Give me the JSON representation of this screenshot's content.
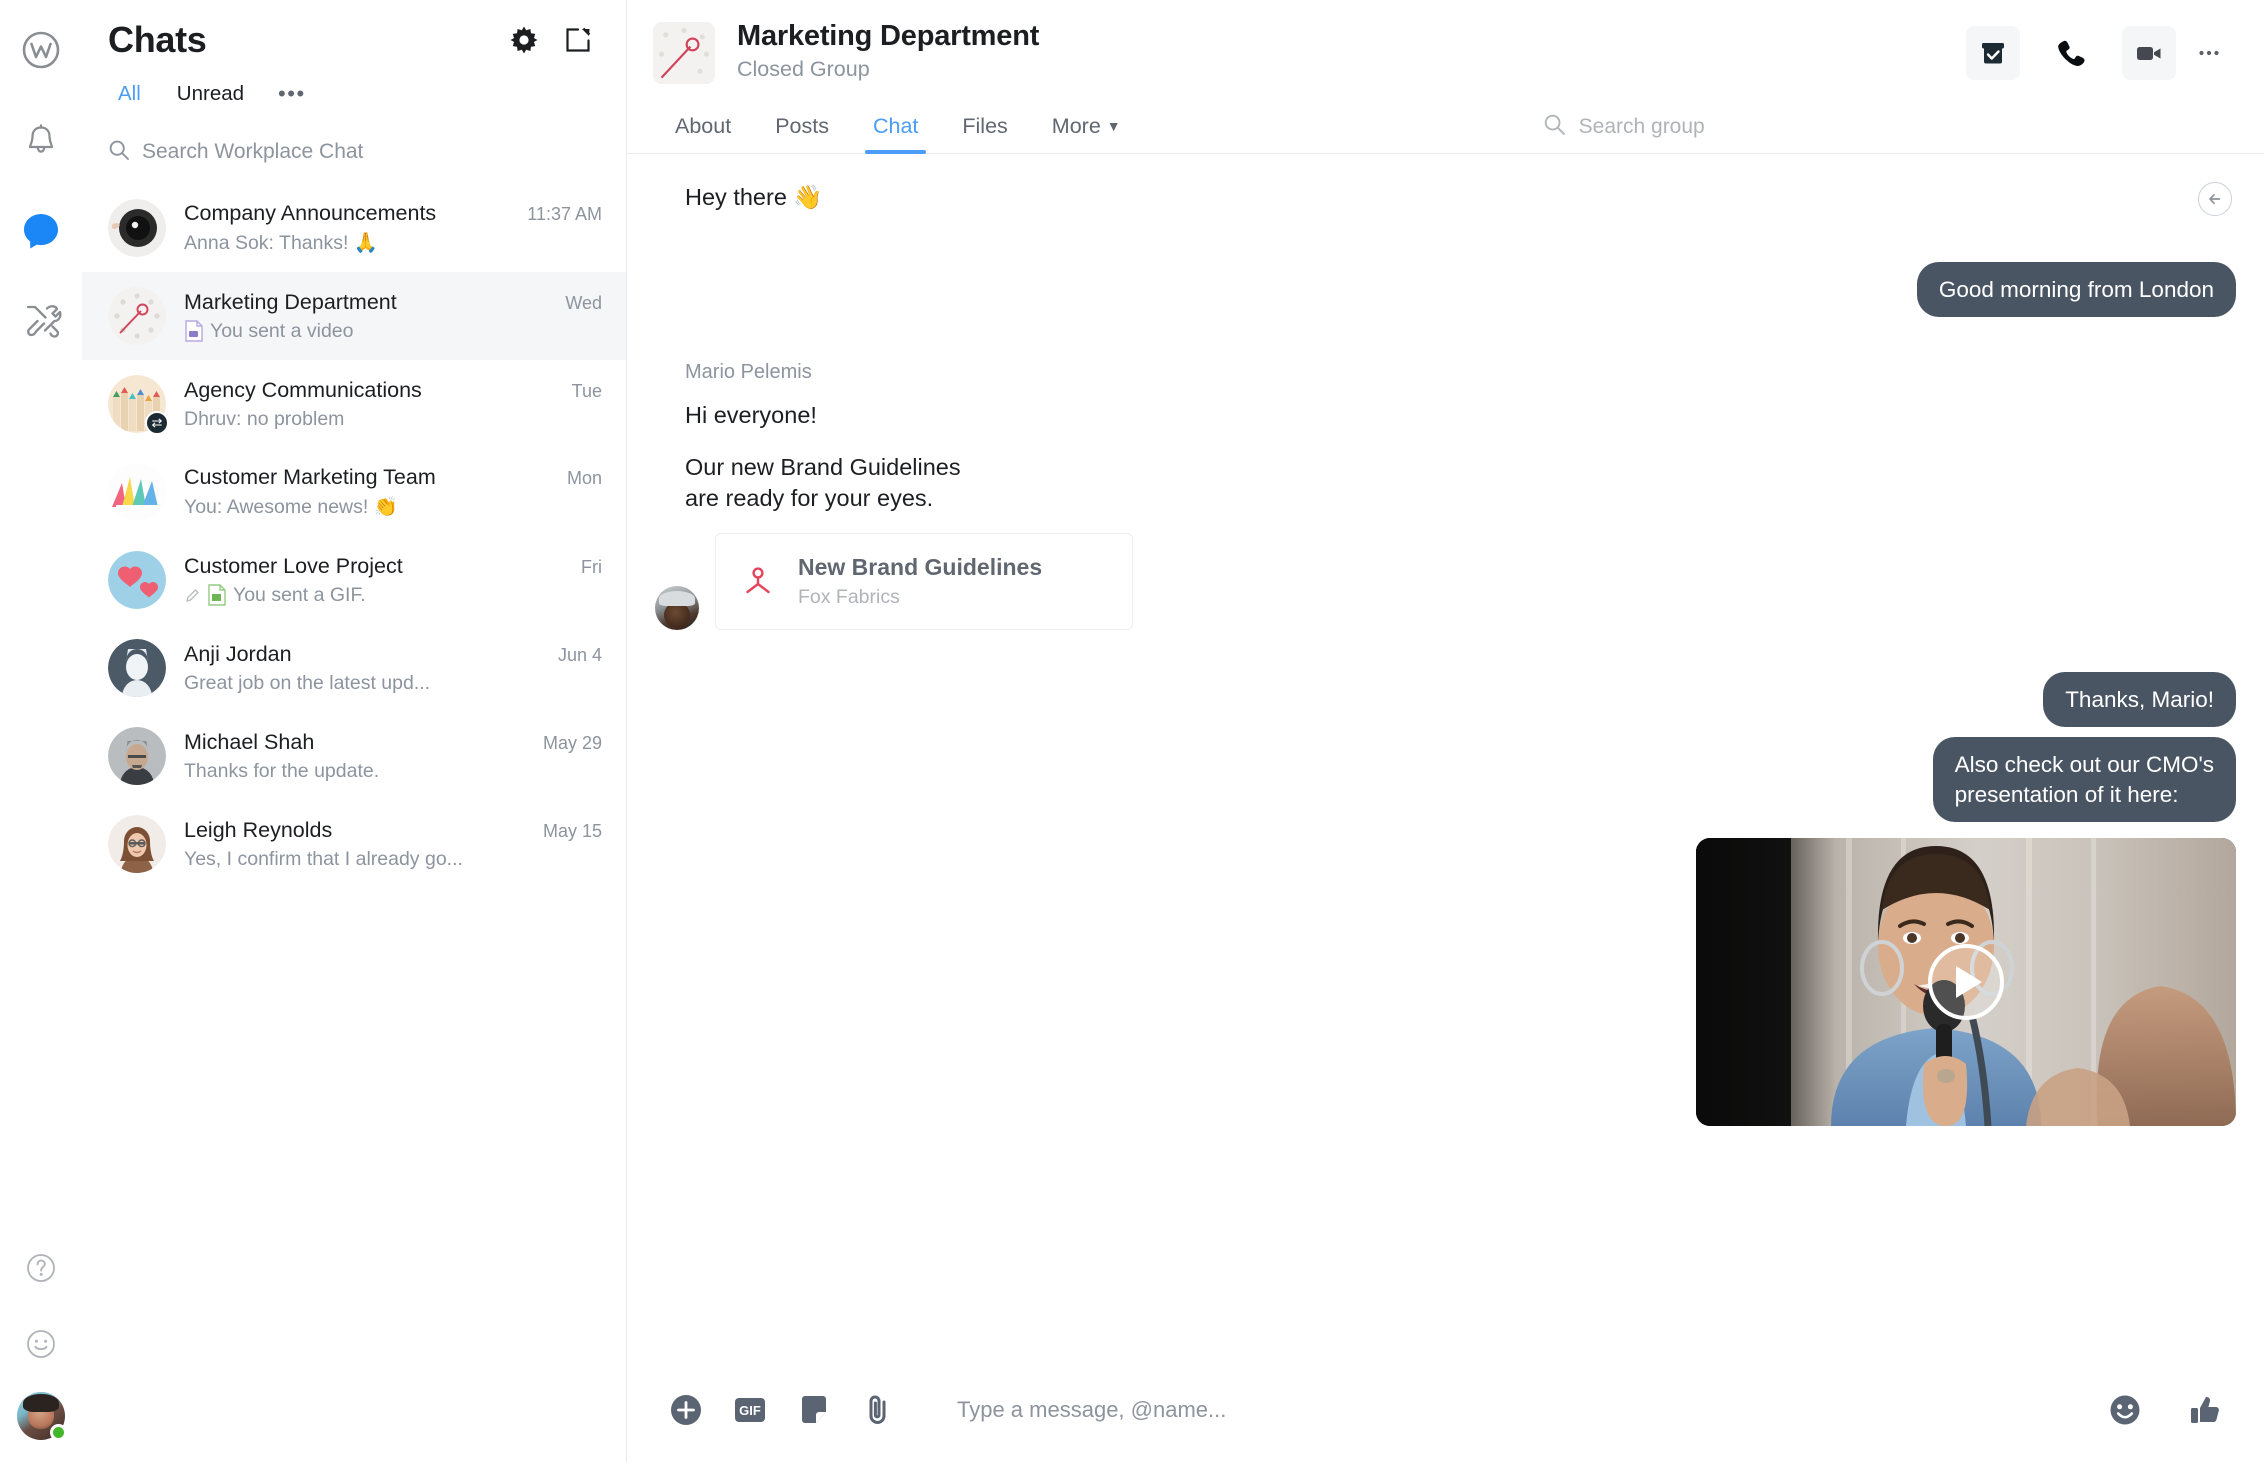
{
  "rail": {
    "items": [
      {
        "name": "workplace-logo-icon",
        "label": "Workplace"
      },
      {
        "name": "notifications-icon",
        "label": "Notifications"
      },
      {
        "name": "chat-icon",
        "label": "Chat"
      },
      {
        "name": "tools-icon",
        "label": "Tools"
      }
    ],
    "bottom": [
      {
        "name": "help-icon",
        "label": "Help"
      },
      {
        "name": "feedback-icon",
        "label": "Feedback"
      }
    ],
    "accent_color": "#1b87f7",
    "status_color": "#42b72a"
  },
  "sidebar": {
    "title": "Chats",
    "settings_label": "Settings",
    "compose_label": "New message",
    "filters": [
      {
        "label": "All",
        "active": true
      },
      {
        "label": "Unread",
        "active": false
      },
      {
        "label": "•••",
        "active": false
      }
    ],
    "search": {
      "placeholder": "Search Workplace Chat"
    },
    "chats": [
      {
        "name": "Company Announcements",
        "time": "11:37 AM",
        "snippet": "Anna Sok: Thanks! 🙏",
        "selected": false,
        "attachment_icon": "",
        "avatar_kind": "speaker"
      },
      {
        "name": "Marketing Department",
        "time": "Wed",
        "snippet": "You sent a video",
        "selected": true,
        "attachment_icon": "video-file-icon",
        "avatar_kind": "pin"
      },
      {
        "name": "Agency Communications",
        "time": "Tue",
        "snippet": "Dhruv: no problem",
        "selected": false,
        "attachment_icon": "",
        "avatar_kind": "pencils",
        "badge": "⇄"
      },
      {
        "name": "Customer Marketing Team",
        "time": "Mon",
        "snippet": "You: Awesome news! 👏",
        "selected": false,
        "attachment_icon": "",
        "avatar_kind": "origami"
      },
      {
        "name": "Customer Love Project",
        "time": "Fri",
        "snippet": "You sent a GIF.",
        "selected": false,
        "attachment_icon": "gif-file-icon",
        "avatar_kind": "hearts"
      },
      {
        "name": "Anji Jordan",
        "time": "Jun 4",
        "snippet": "Great job on the latest upd...",
        "selected": false,
        "attachment_icon": "",
        "avatar_kind": "person-anji"
      },
      {
        "name": "Michael Shah",
        "time": "May 29",
        "snippet": "Thanks for the update.",
        "selected": false,
        "attachment_icon": "",
        "avatar_kind": "person-michael"
      },
      {
        "name": "Leigh Reynolds",
        "time": "May 15",
        "snippet": "Yes, I confirm that I already go...",
        "selected": false,
        "attachment_icon": "",
        "avatar_kind": "person-leigh"
      }
    ]
  },
  "group": {
    "title": "Marketing Department",
    "subtitle": "Closed Group",
    "actions": [
      {
        "name": "archive-icon",
        "label": "Archive"
      },
      {
        "name": "phone-icon",
        "label": "Audio call"
      },
      {
        "name": "video-icon",
        "label": "Video call"
      },
      {
        "name": "more-options-icon",
        "label": "More options"
      }
    ],
    "tabs": [
      {
        "label": "About",
        "active": false
      },
      {
        "label": "Posts",
        "active": false
      },
      {
        "label": "Chat",
        "active": true
      },
      {
        "label": "Files",
        "active": false
      },
      {
        "label": "More",
        "active": false,
        "caret": true
      }
    ],
    "search": {
      "placeholder": "Search group"
    }
  },
  "thread": {
    "jump_back_label": "Jump to latest",
    "messages": [
      {
        "type": "incoming-plain",
        "text": "Hey there 👋"
      },
      {
        "type": "outgoing",
        "text": "Good morning from London"
      },
      {
        "type": "sender-label",
        "text": "Mario Pelemis"
      },
      {
        "type": "incoming-plain",
        "text": "Hi everyone!"
      },
      {
        "type": "incoming-plain",
        "text": "Our new Brand Guidelines\nare ready for your eyes."
      },
      {
        "type": "file-card",
        "file_title": "New Brand Guidelines",
        "file_sub": "Fox Fabrics",
        "file_icon": "pdf-icon"
      },
      {
        "type": "outgoing",
        "text": "Thanks, Mario!"
      },
      {
        "type": "outgoing",
        "text": "Also check out our CMO's\npresentation of it here:"
      },
      {
        "type": "video",
        "play_label": "Play video"
      }
    ],
    "bubble_color": "#4a5564"
  },
  "composer": {
    "placeholder": "Type a message, @name...",
    "left_buttons": [
      {
        "name": "add-attachment-icon",
        "label": "Add"
      },
      {
        "name": "gif-icon",
        "label": "GIF"
      },
      {
        "name": "sticker-icon",
        "label": "Sticker"
      },
      {
        "name": "paperclip-icon",
        "label": "Attach file"
      }
    ],
    "right_buttons": [
      {
        "name": "emoji-icon",
        "label": "Emoji"
      },
      {
        "name": "thumbs-up-icon",
        "label": "Like"
      }
    ]
  }
}
